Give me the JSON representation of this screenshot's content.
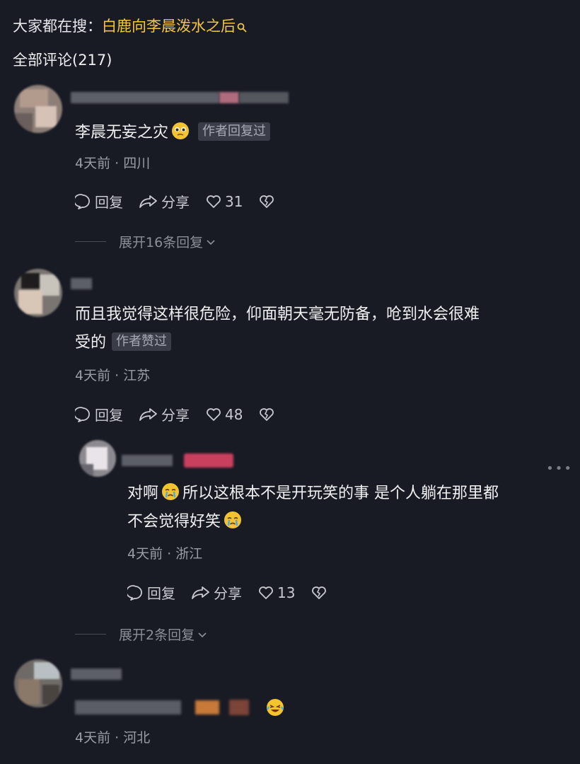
{
  "trending": {
    "prefix": "大家都在搜：",
    "topic": "白鹿向李晨泼水之后",
    "icon": "search-icon"
  },
  "comments_header": {
    "label": "全部评论(217)"
  },
  "comments": [
    {
      "text": "李晨无妄之灾",
      "emoji": "face-with-pleading-eyes",
      "badge": "作者回复过",
      "date": "4天前",
      "location": "四川",
      "reply_label": "回复",
      "share_label": "分享",
      "likes": "31",
      "expand_label": "展开16条回复"
    },
    {
      "text_line1": "而且我觉得这样很危险，仰面朝天毫无防备，呛到水会很难",
      "text_line2": "受的",
      "badge": "作者赞过",
      "date": "4天前",
      "location": "江苏",
      "reply_label": "回复",
      "share_label": "分享",
      "likes": "48"
    },
    {
      "text_part1": "对啊",
      "text_part2": "所以这根本不是开玩笑的事 是个人躺在那里都",
      "text_line2": "不会觉得好笑",
      "emoji": "crying-face",
      "date": "4天前",
      "location": "浙江",
      "reply_label": "回复",
      "share_label": "分享",
      "likes": "13",
      "expand_label": "展开2条回复"
    },
    {
      "date": "4天前",
      "location": "河北"
    }
  ],
  "colors": {
    "background": "#181a24",
    "topic": "#f2c744",
    "badge_bg": "#3a3c48"
  }
}
